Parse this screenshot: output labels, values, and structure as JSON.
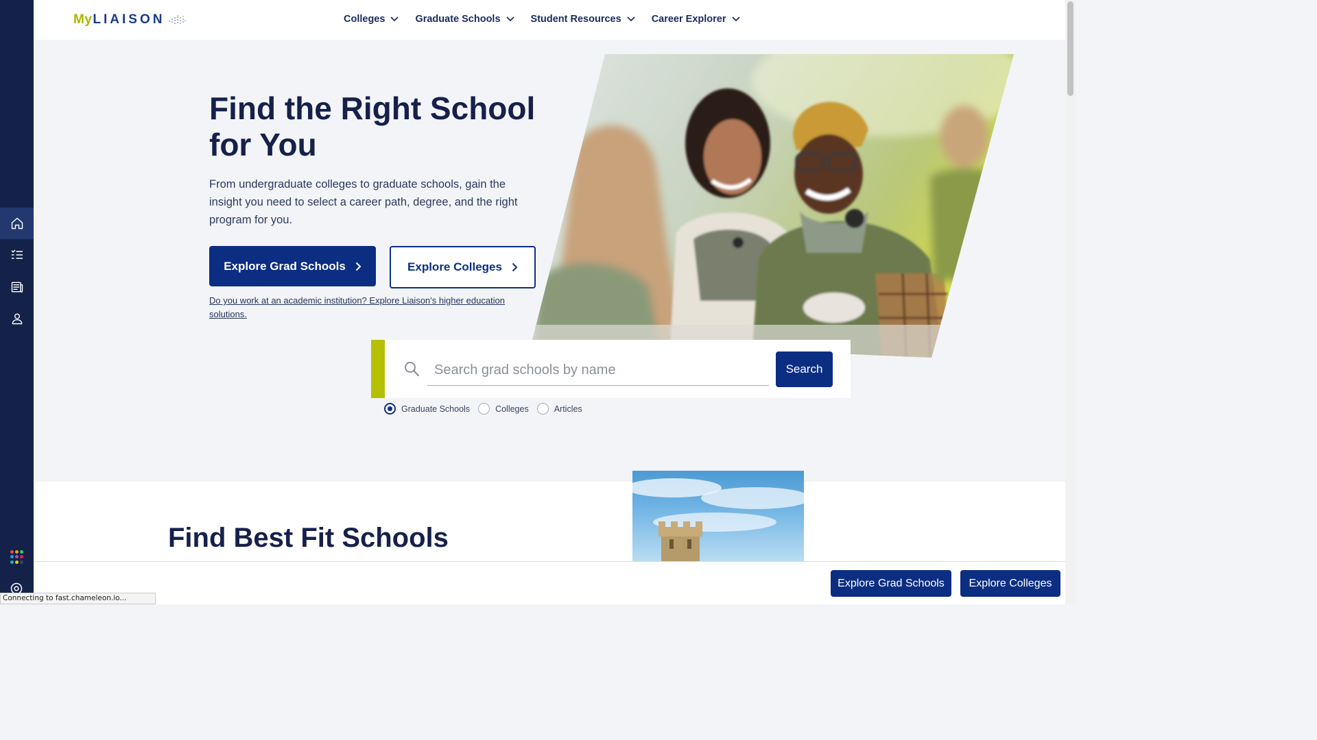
{
  "header": {
    "logo": {
      "my": "My",
      "liaison": "LIAISON"
    },
    "nav": [
      {
        "label": "Colleges"
      },
      {
        "label": "Graduate Schools"
      },
      {
        "label": "Student Resources"
      },
      {
        "label": "Career Explorer"
      }
    ]
  },
  "sidebar": {
    "items": [
      {
        "icon": "home-icon",
        "active": true
      },
      {
        "icon": "checklist-icon",
        "active": false
      },
      {
        "icon": "articles-icon",
        "active": false
      },
      {
        "icon": "profile-icon",
        "active": false
      }
    ],
    "apps_colors": [
      "#e84c3d",
      "#f39c12",
      "#2ecc71",
      "#3498db",
      "#9b59b6",
      "#e91e63",
      "#1abc9c",
      "#f1c40f",
      "#34495e"
    ]
  },
  "hero": {
    "title": "Find the Right School for You",
    "description": "From undergraduate colleges to graduate schools, gain the insight you need to select a career path, degree, and the right program for you.",
    "primary_button": "Explore Grad Schools",
    "secondary_button": "Explore Colleges",
    "institution_link": "Do you work at an academic institution? Explore Liaison's higher education solutions."
  },
  "search": {
    "placeholder": "Search grad schools by name",
    "value": "",
    "button": "Search",
    "options": [
      {
        "label": "Graduate Schools",
        "checked": true
      },
      {
        "label": "Colleges",
        "checked": false
      },
      {
        "label": "Articles",
        "checked": false
      }
    ]
  },
  "section2": {
    "title": "Find Best Fit Schools"
  },
  "sticky_footer": {
    "grad_button": "Explore Grad Schools",
    "colleges_button": "Explore Colleges"
  },
  "status_bar": "Connecting to fast.chameleon.io...",
  "colors": {
    "navy": "#0c2e82",
    "accent_lime": "#b5c000",
    "rail": "#14224a"
  }
}
